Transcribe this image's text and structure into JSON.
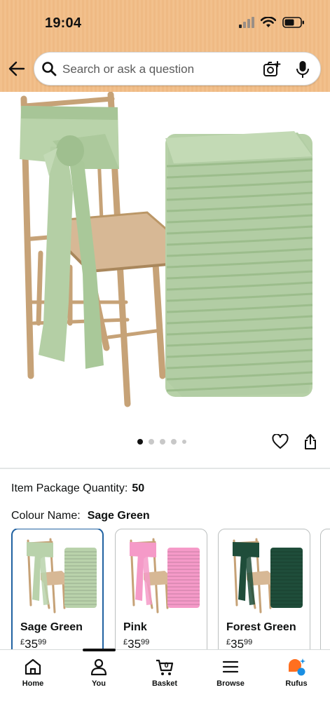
{
  "status_bar": {
    "time": "19:04"
  },
  "search": {
    "placeholder": "Search or ask a question"
  },
  "gallery": {
    "image_count": 5,
    "active_index": 0
  },
  "product": {
    "package_quantity_label": "Item Package Quantity:",
    "package_quantity_value": "50",
    "colour_label": "Colour Name:",
    "colour_value": "Sage Green"
  },
  "swatches": [
    {
      "name": "Sage Green",
      "currency": "£",
      "price_whole": "35",
      "price_fraction": "99",
      "color": "#b9d2ab",
      "selected": true
    },
    {
      "name": "Pink",
      "currency": "£",
      "price_whole": "35",
      "price_fraction": "99",
      "color": "#f59ac8",
      "selected": false
    },
    {
      "name": "Forest Green",
      "currency": "£",
      "price_whole": "35",
      "price_fraction": "99",
      "color": "#1f4d3a",
      "selected": false
    }
  ],
  "bottom_nav": {
    "items": [
      {
        "label": "Home",
        "icon": "home-icon"
      },
      {
        "label": "You",
        "icon": "user-icon"
      },
      {
        "label": "Basket",
        "icon": "basket-icon",
        "count": "0"
      },
      {
        "label": "Browse",
        "icon": "menu-icon"
      },
      {
        "label": "Rufus",
        "icon": "rufus-icon"
      }
    ]
  },
  "colors": {
    "header": "#f2c08c",
    "accent_selected": "#2162a1",
    "product_green": "#b9d2ab",
    "chair_gold": "#c6a277"
  }
}
